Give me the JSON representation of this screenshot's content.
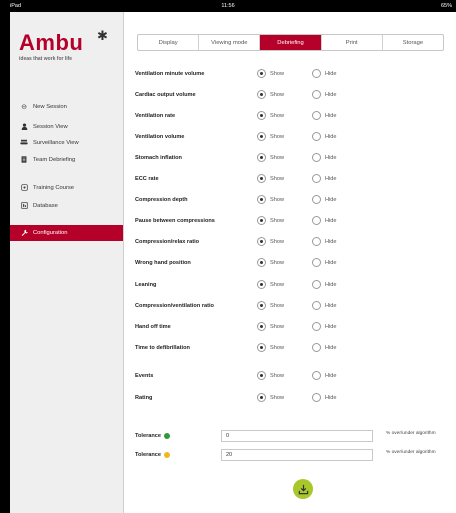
{
  "status_bar": {
    "carrier": "iPad",
    "time": "11:56",
    "battery": "65%"
  },
  "logo": {
    "word": "Ambu",
    "tagline": "ideas that work for life"
  },
  "sidebar": {
    "items": [
      {
        "label": "New Session",
        "icon": "new-session-icon"
      },
      {
        "label": "Session View",
        "icon": "person-icon"
      },
      {
        "label": "Surveillance View",
        "icon": "group-icon"
      },
      {
        "label": "Team Debriefing",
        "icon": "document-icon"
      },
      {
        "label": "Training Course",
        "icon": "training-icon"
      },
      {
        "label": "Database",
        "icon": "database-icon"
      },
      {
        "label": "Configuration",
        "icon": "wrench-icon",
        "active": true
      }
    ]
  },
  "tabs": [
    {
      "label": "Display"
    },
    {
      "label": "Viewing mode"
    },
    {
      "label": "Debriefing",
      "active": true
    },
    {
      "label": "Print"
    },
    {
      "label": "Storage"
    }
  ],
  "options": {
    "show_label": "Show",
    "hide_label": "Hide",
    "rows": [
      {
        "label": "Ventilation minute volume",
        "value": "Show"
      },
      {
        "label": "Cardiac output volume",
        "value": "Show"
      },
      {
        "label": "Ventilation rate",
        "value": "Show"
      },
      {
        "label": "Ventilation volume",
        "value": "Show"
      },
      {
        "label": "Stomach inflation",
        "value": "Show"
      },
      {
        "label": "ECC rate",
        "value": "Show"
      },
      {
        "label": "Compression depth",
        "value": "Show"
      },
      {
        "label": "Pause between compressions",
        "value": "Show"
      },
      {
        "label": "Compression/relax ratio",
        "value": "Show"
      },
      {
        "label": "Wrong hand position",
        "value": "Show"
      },
      {
        "label": "Leaning",
        "value": "Show"
      },
      {
        "label": "Compression/ventilation ratio",
        "value": "Show"
      },
      {
        "label": "Hand off time",
        "value": "Show"
      },
      {
        "label": "Time to defibrillation",
        "value": "Show"
      },
      {
        "label": "Events",
        "value": "Show"
      },
      {
        "label": "Rating",
        "value": "Show"
      }
    ]
  },
  "tolerance": [
    {
      "label": "Tolerance",
      "color": "#2e9b3a",
      "value": "0",
      "suffix": "% over/under algorithm"
    },
    {
      "label": "Tolerance",
      "color": "#f2b61e",
      "value": "20",
      "suffix": "% over/under algorithm"
    }
  ],
  "colors": {
    "accent": "#b5002a",
    "save_button": "#a8c72a"
  },
  "save_button": {
    "icon": "save-download-icon"
  }
}
